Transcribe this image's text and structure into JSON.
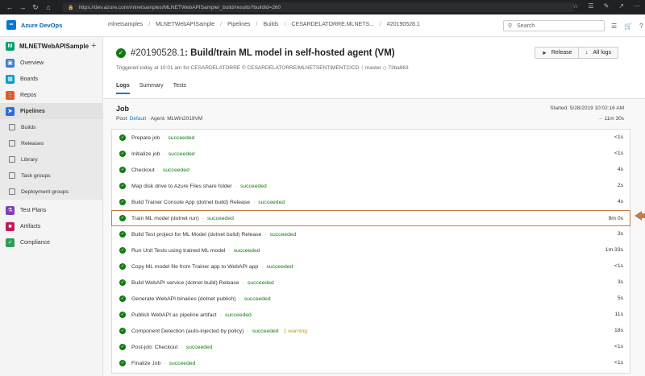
{
  "browser": {
    "url": "https://dev.azure.com/mlnetsamples/MLNETWebAPISample/_build/results?buildId=260"
  },
  "topbar": {
    "brand": "Azure DevOps",
    "breadcrumbs": [
      "mlnetsamples",
      "MLNETWebAPISample",
      "Pipelines",
      "Builds",
      "CESARDELATORRE.MLNETS...",
      "#20190528.1"
    ],
    "search_placeholder": "Search"
  },
  "sidebar": {
    "project": "MLNETWebAPISample",
    "project_initial": "M",
    "items": [
      {
        "label": "Overview",
        "color": "#3d7dd8"
      },
      {
        "label": "Boards",
        "color": "#009ccc"
      },
      {
        "label": "Repos",
        "color": "#e05b2f"
      },
      {
        "label": "Pipelines",
        "color": "#2f6ed8"
      }
    ],
    "sub_items": [
      "Builds",
      "Releases",
      "Library",
      "Task groups",
      "Deployment groups"
    ],
    "bottom_items": [
      {
        "label": "Test Plans",
        "color": "#7e3fb8"
      },
      {
        "label": "Artifacts",
        "color": "#c2185b"
      },
      {
        "label": "Compliance",
        "color": "#2e9e57"
      }
    ]
  },
  "build": {
    "run_number": "#20190528.1",
    "title_rest": ": Build/train ML model in self-hosted agent (VM)",
    "subline": "Triggered today at 10:01 am for CESARDELATORRE  © CESARDELATORRE/MLNETSENTIMENTCICD  ᚽ master  ◇ 73ba963",
    "release_label": "Release",
    "logs_label": "All logs",
    "tabs": [
      "Logs",
      "Summary",
      "Tests"
    ]
  },
  "job": {
    "title": "Job",
    "pool_prefix": "Pool:",
    "pool_link": "Default",
    "agent": "· Agent: MLWin2019VM",
    "started": "Started: 5/28/2019 10:02:16 AM",
    "duration": "··· 11m 30s",
    "highlight_color": "#c77b46",
    "steps": [
      {
        "name": "Prepare job",
        "status": "succeeded",
        "warning": "",
        "duration": "<1s"
      },
      {
        "name": "Initialize job",
        "status": "succeeded",
        "warning": "",
        "duration": "<1s"
      },
      {
        "name": "Checkout",
        "status": "succeeded",
        "warning": "",
        "duration": "4s"
      },
      {
        "name": "Map disk drive to Azure Files share folder",
        "status": "succeeded",
        "warning": "",
        "duration": "2s"
      },
      {
        "name": "Build Trainer Console App (dotnet build) Release",
        "status": "succeeded",
        "warning": "",
        "duration": "4s"
      },
      {
        "name": "Train ML model (dotnet run)",
        "status": "succeeded",
        "warning": "",
        "duration": "9m 0s",
        "highlight": true
      },
      {
        "name": "Build Test project for ML Model (dotnet build) Release",
        "status": "succeeded",
        "warning": "",
        "duration": "3s"
      },
      {
        "name": "Run Unit Tests using trained ML model",
        "status": "succeeded",
        "warning": "",
        "duration": "1m 33s"
      },
      {
        "name": "Copy ML model file from Trainer app to WebAPI app",
        "status": "succeeded",
        "warning": "",
        "duration": "<1s"
      },
      {
        "name": "Build WebAPI service (dotnet build) Release",
        "status": "succeeded",
        "warning": "",
        "duration": "3s"
      },
      {
        "name": "Generate WebAPI binaries (dotnet publish)",
        "status": "succeeded",
        "warning": "",
        "duration": "5s"
      },
      {
        "name": "Publish WebAPI as pipeline artifact",
        "status": "succeeded",
        "warning": "",
        "duration": "11s"
      },
      {
        "name": "Component Detection (auto-injected by policy)",
        "status": "succeeded",
        "warning": "1 warning",
        "duration": "18s"
      },
      {
        "name": "Post-job: Checkout",
        "status": "succeeded",
        "warning": "",
        "duration": "<1s"
      },
      {
        "name": "Finalize Job",
        "status": "succeeded",
        "warning": "",
        "duration": "<1s"
      }
    ]
  }
}
